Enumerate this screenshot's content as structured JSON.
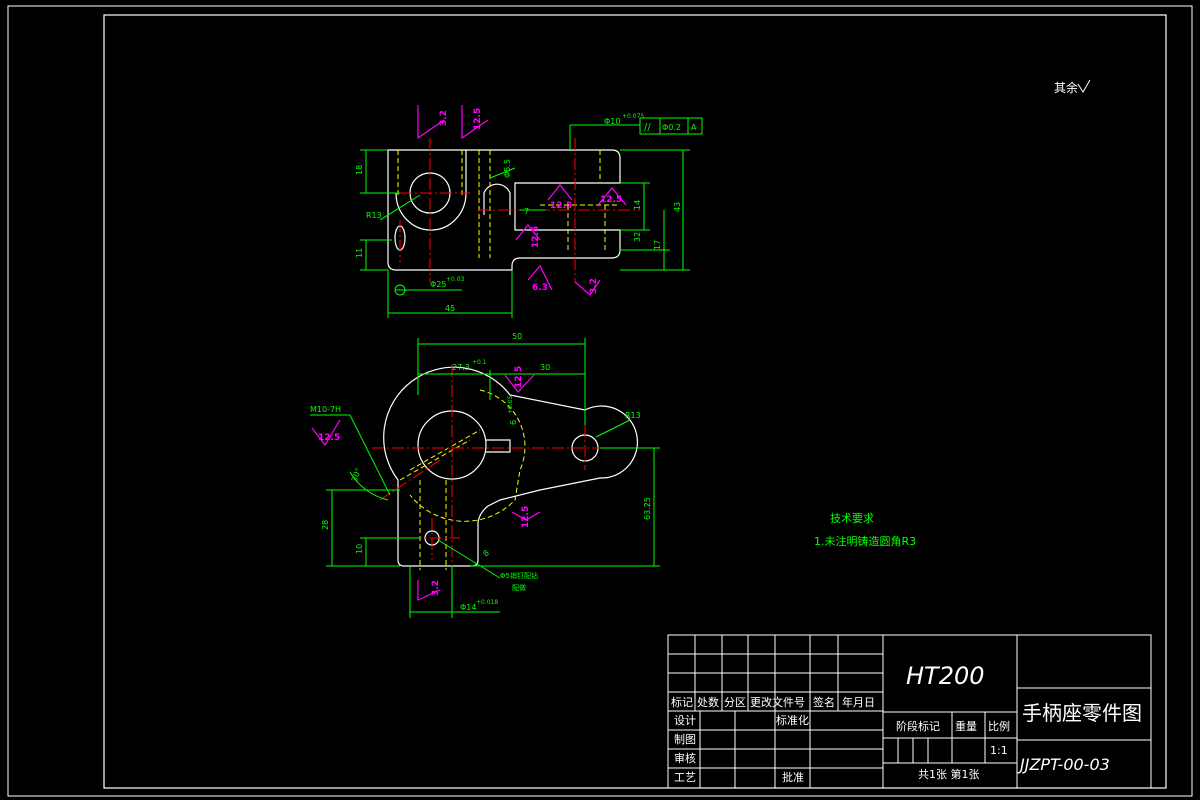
{
  "drawing": {
    "roughness_note": "其余",
    "tech_req_title": "技术要求",
    "tech_req_item": "1.未注明铸造圆角R3"
  },
  "colors": {
    "background": "#000000",
    "outline": "#ffffff",
    "dimension": "#00ff00",
    "centerline": "#ff0000",
    "hidden": "#ffff00",
    "roughness": "#ff00ff"
  },
  "top_view": {
    "roughness_symbols": [
      "3.2",
      "12.5",
      "12.5",
      "12.5",
      "12.5",
      "6.3",
      "3.2"
    ],
    "dims": {
      "tol_diameter": "Φ10",
      "tol_diameter_dev": "+0.075",
      "tol_symbol": "//",
      "tol_value": "Φ0.2",
      "tol_datum": "A",
      "d1": "Φ5.5",
      "d2": "7",
      "d3": "14",
      "d4": "32",
      "d5": "17",
      "d6": "43",
      "d7": "18",
      "d8": "11",
      "r13": "R13",
      "bore": "Φ25",
      "bore_dev": "+0.03",
      "length": "45"
    }
  },
  "front_view": {
    "roughness_symbols": [
      "12.5",
      "12.5",
      "12.5",
      "3.2"
    ],
    "dims": {
      "d50": "50",
      "d27": "27.3",
      "d27_dev": "+0.1",
      "d30": "30",
      "thread": "M10-7H",
      "r13": "R13",
      "d6": "6",
      "d6_dev": "+0.05",
      "ang": "30°",
      "d63": "63.25",
      "d28": "28",
      "d10": "10",
      "d4": "8",
      "pin": "Φ5销钉配钻",
      "pin_note": "配做",
      "d14": "Φ14",
      "d14_dev": "+0.018"
    }
  },
  "title_block": {
    "material": "HT200",
    "part_name": "手柄座零件图",
    "drawing_no": "JJZPT-00-03",
    "headers": [
      "标记",
      "处数",
      "分区",
      "更改文件号",
      "签名",
      "年月日"
    ],
    "design": "设计",
    "standardization": "标准化",
    "drafting": "制图",
    "checking": "审核",
    "process": "工艺",
    "approval": "批准",
    "stage_mark": "阶段标记",
    "weight": "重量",
    "scale_label": "比例",
    "scale_value": "1:1",
    "sheets": "共1张  第1张"
  }
}
